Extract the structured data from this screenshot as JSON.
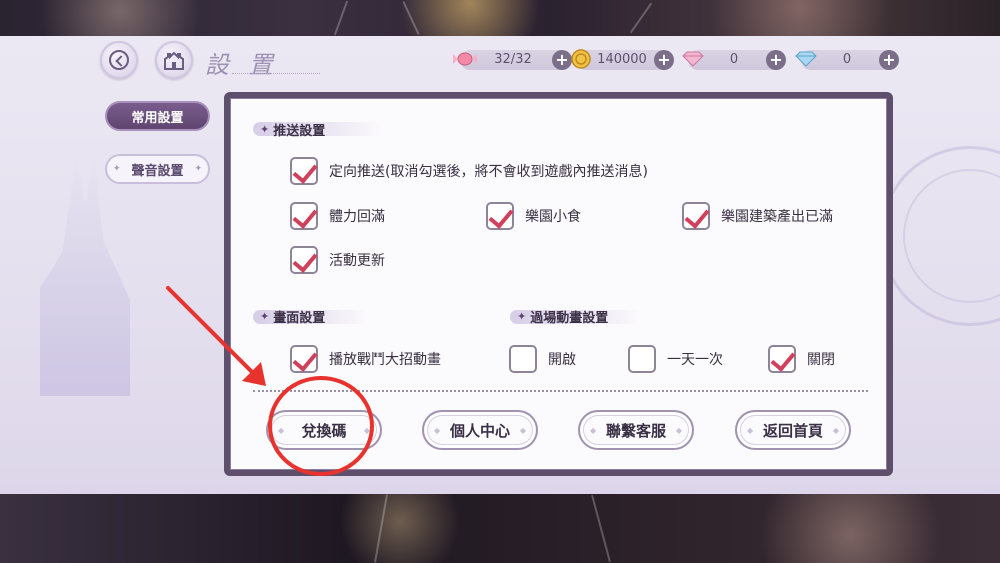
{
  "header": {
    "title": "設 置"
  },
  "resources": [
    {
      "icon": "candy-icon",
      "value": "32/32"
    },
    {
      "icon": "coin-icon",
      "value": "140000"
    },
    {
      "icon": "pink-diamond-icon",
      "value": "0"
    },
    {
      "icon": "blue-diamond-icon",
      "value": "0"
    }
  ],
  "tabs": [
    {
      "label": "常用設置",
      "active": true
    },
    {
      "label": "聲音設置",
      "active": false
    }
  ],
  "sections": {
    "push": {
      "label": "推送設置",
      "options": [
        {
          "label": "定向推送(取消勾選後，將不會收到遊戲內推送消息)",
          "checked": true
        },
        {
          "label": "體力回滿",
          "checked": true
        },
        {
          "label": "樂園小食",
          "checked": true
        },
        {
          "label": "樂園建築產出已滿",
          "checked": true
        },
        {
          "label": "活動更新",
          "checked": true
        }
      ]
    },
    "display": {
      "label": "畫面設置",
      "options": [
        {
          "label": "播放戰鬥大招動畫",
          "checked": true
        }
      ]
    },
    "transition": {
      "label": "過場動畫設置",
      "options": [
        {
          "label": "開啟",
          "checked": false
        },
        {
          "label": "一天一次",
          "checked": false
        },
        {
          "label": "關閉",
          "checked": true
        }
      ]
    }
  },
  "actions": {
    "redeem_code": "兌換碼",
    "personal_center": "個人中心",
    "contact_support": "聯繫客服",
    "return_home": "返回首頁"
  },
  "colors": {
    "accent_purple": "#5e4f6c",
    "check_red": "#d0405a",
    "annotation_red": "#e8322e"
  }
}
